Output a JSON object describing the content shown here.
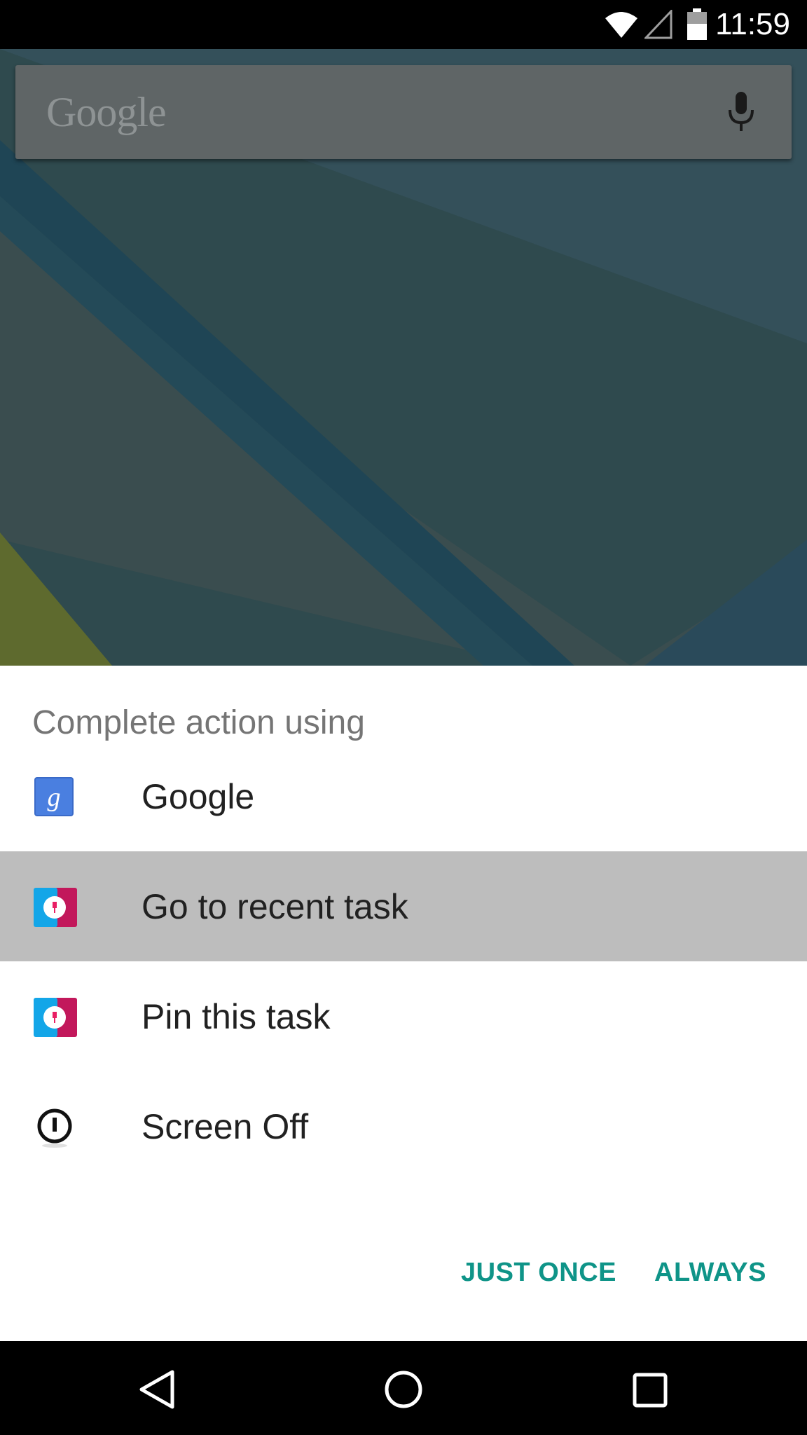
{
  "status_bar": {
    "time": "11:59",
    "icons": [
      "wifi-icon",
      "cell-signal-icon",
      "battery-icon"
    ]
  },
  "search_bar": {
    "logo_text": "Google",
    "mic_icon": "mic-icon"
  },
  "dialog": {
    "title": "Complete action using",
    "options": [
      {
        "label": "Google",
        "icon": "google-app-icon",
        "selected": false
      },
      {
        "label": "Go to recent task",
        "icon": "recent-task-app-icon",
        "selected": true
      },
      {
        "label": "Pin this task",
        "icon": "pin-task-app-icon",
        "selected": false
      },
      {
        "label": "Screen Off",
        "icon": "screen-off-icon",
        "selected": false
      }
    ],
    "buttons": {
      "just_once": "JUST ONCE",
      "always": "ALWAYS"
    }
  },
  "nav_bar": {
    "icons": [
      "back-icon",
      "home-icon",
      "recents-icon"
    ]
  },
  "colors": {
    "accent": "#0f9488",
    "selected_row": "#bdbdbd",
    "wallpaper": "#2f4a4e"
  }
}
